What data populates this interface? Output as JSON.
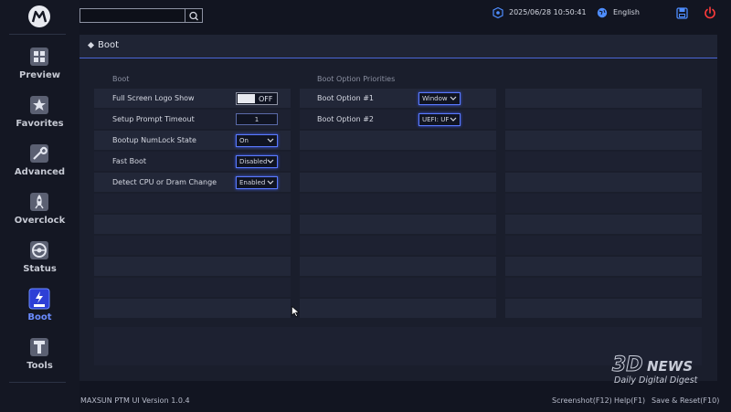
{
  "header": {
    "search": {
      "value": "",
      "placeholder": ""
    },
    "datetime": "2025/06/28 10:50:41",
    "language": "English"
  },
  "sidebar": {
    "items": [
      {
        "label": "Preview",
        "icon": "preview-icon"
      },
      {
        "label": "Favorites",
        "icon": "star-icon"
      },
      {
        "label": "Advanced",
        "icon": "wrench-icon"
      },
      {
        "label": "Overclock",
        "icon": "rocket-icon"
      },
      {
        "label": "Status",
        "icon": "gauge-icon"
      },
      {
        "label": "Boot",
        "icon": "boot-ssd-icon",
        "active": true
      },
      {
        "label": "Tools",
        "icon": "tools-icon"
      }
    ]
  },
  "page": {
    "title": "Boot"
  },
  "boot": {
    "heading": "Boot",
    "settings": [
      {
        "label": "Full Screen Logo Show",
        "control": "toggle",
        "value": "OFF"
      },
      {
        "label": "Setup Prompt Timeout",
        "control": "input",
        "value": "1"
      },
      {
        "label": "Bootup NumLock State",
        "control": "select",
        "value": "On"
      },
      {
        "label": "Fast Boot",
        "control": "select",
        "value": "Disabled"
      },
      {
        "label": "Detect CPU or Dram Change",
        "control": "select",
        "value": "Enabled"
      }
    ]
  },
  "priorities": {
    "heading": "Boot Option Priorities",
    "options": [
      {
        "label": "Boot Option #1",
        "value": "Window"
      },
      {
        "label": "Boot Option #2",
        "value": "UEFI: UF"
      }
    ]
  },
  "footer": {
    "version": "MAXSUN PTM UI Version 1.0.4",
    "screenshot": "Screenshot(F12)",
    "help": "Help(F1)",
    "save_reset": "Save & Reset(F10)"
  },
  "watermark": {
    "brand": "3DNEWS",
    "tagline": "Daily Digital Digest"
  },
  "colors": {
    "accent": "#5a7aff",
    "active_nav": "#6b8cff",
    "background": "#121521",
    "panel": "#1a1e2c"
  }
}
